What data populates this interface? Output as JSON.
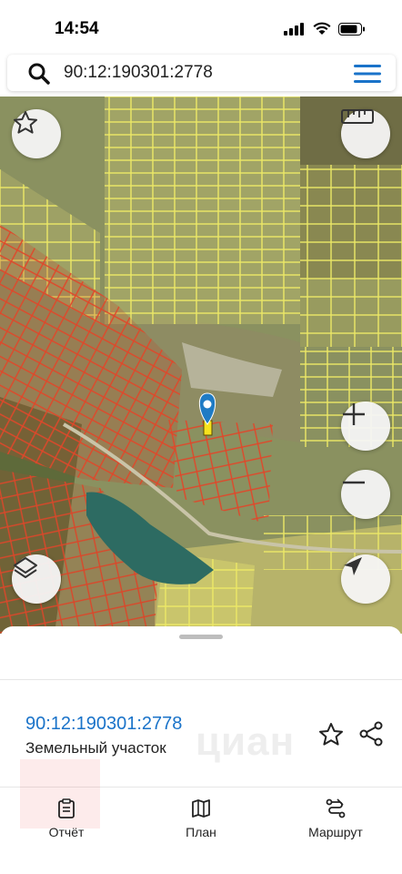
{
  "status_bar": {
    "time": "14:54"
  },
  "search": {
    "query": "90:12:190301:2778"
  },
  "map": {
    "buttons": [
      "favorite",
      "ruler",
      "zoom-in",
      "zoom-out",
      "layers",
      "locate"
    ]
  },
  "parcel": {
    "cadastral_number": "90:12:190301:2778",
    "type": "Земельный участок"
  },
  "watermark": {
    "text": "циан"
  },
  "tabs": [
    {
      "label": "Отчёт",
      "icon": "clipboard-icon"
    },
    {
      "label": "План",
      "icon": "map-icon"
    },
    {
      "label": "Маршрут",
      "icon": "route-icon"
    }
  ],
  "colors": {
    "accent": "#1a73c9",
    "parcel_outline_red": "#e0472a",
    "parcel_outline_yellow": "#e8e35a",
    "marker": "#1f7bc4"
  }
}
